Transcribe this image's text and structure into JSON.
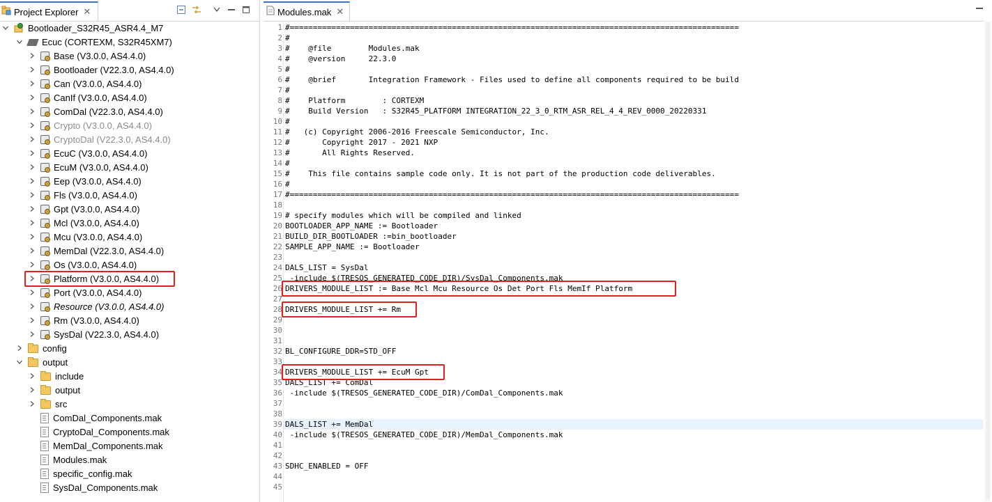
{
  "left_panel": {
    "tab_label": "Project Explorer",
    "tree": [
      {
        "label": "Bootloader_S32R45_ASR4.4_M7",
        "depth": 0,
        "expanded": true,
        "icon": "project-icon"
      },
      {
        "label": "Ecuc (CORTEXM, S32R45XM7)",
        "depth": 1,
        "expanded": true,
        "icon": "chip-icon"
      },
      {
        "label": "Base (V3.0.0, AS4.4.0)",
        "depth": 2,
        "icon": "module-icon"
      },
      {
        "label": "Bootloader (V22.3.0, AS4.4.0)",
        "depth": 2,
        "icon": "module-icon"
      },
      {
        "label": "Can (V3.0.0, AS4.4.0)",
        "depth": 2,
        "icon": "module-icon"
      },
      {
        "label": "CanIf (V3.0.0, AS4.4.0)",
        "depth": 2,
        "icon": "module-icon"
      },
      {
        "label": "ComDal (V22.3.0, AS4.4.0)",
        "depth": 2,
        "icon": "module-icon"
      },
      {
        "label": "Crypto (V3.0.0, AS4.4.0)",
        "depth": 2,
        "icon": "module-icon",
        "disabled": true
      },
      {
        "label": "CryptoDal (V22.3.0, AS4.4.0)",
        "depth": 2,
        "icon": "module-icon",
        "disabled": true
      },
      {
        "label": "EcuC (V3.0.0, AS4.4.0)",
        "depth": 2,
        "icon": "module-icon"
      },
      {
        "label": "EcuM (V3.0.0, AS4.4.0)",
        "depth": 2,
        "icon": "module-icon"
      },
      {
        "label": "Eep (V3.0.0, AS4.4.0)",
        "depth": 2,
        "icon": "module-icon"
      },
      {
        "label": "Fls (V3.0.0, AS4.4.0)",
        "depth": 2,
        "icon": "module-icon"
      },
      {
        "label": "Gpt (V3.0.0, AS4.4.0)",
        "depth": 2,
        "icon": "module-icon"
      },
      {
        "label": "Mcl (V3.0.0, AS4.4.0)",
        "depth": 2,
        "icon": "module-icon"
      },
      {
        "label": "Mcu (V3.0.0, AS4.4.0)",
        "depth": 2,
        "icon": "module-icon"
      },
      {
        "label": "MemDal (V22.3.0, AS4.4.0)",
        "depth": 2,
        "icon": "module-icon"
      },
      {
        "label": "Os (V3.0.0, AS4.4.0)",
        "depth": 2,
        "icon": "module-icon"
      },
      {
        "label": "Platform (V3.0.0, AS4.4.0)",
        "depth": 2,
        "icon": "module-icon",
        "highlighted": true
      },
      {
        "label": "Port (V3.0.0, AS4.4.0)",
        "depth": 2,
        "icon": "module-icon"
      },
      {
        "label": "Resource (V3.0.0, AS4.4.0)",
        "depth": 2,
        "icon": "module-icon",
        "italic": true
      },
      {
        "label": "Rm (V3.0.0, AS4.4.0)",
        "depth": 2,
        "icon": "module-icon"
      },
      {
        "label": "SysDal (V22.3.0, AS4.4.0)",
        "depth": 2,
        "icon": "module-icon"
      },
      {
        "label": "config",
        "depth": 1,
        "expanded": false,
        "icon": "folder-icon"
      },
      {
        "label": "output",
        "depth": 1,
        "expanded": true,
        "icon": "folder-icon"
      },
      {
        "label": "include",
        "depth": 2,
        "expanded": false,
        "icon": "folder-icon"
      },
      {
        "label": "output",
        "depth": 2,
        "expanded": false,
        "icon": "folder-icon"
      },
      {
        "label": "src",
        "depth": 2,
        "expanded": false,
        "icon": "folder-icon"
      },
      {
        "label": "ComDal_Components.mak",
        "depth": 2,
        "icon": "file-icon",
        "leaf": true
      },
      {
        "label": "CryptoDal_Components.mak",
        "depth": 2,
        "icon": "file-icon",
        "leaf": true
      },
      {
        "label": "MemDal_Components.mak",
        "depth": 2,
        "icon": "file-icon",
        "leaf": true
      },
      {
        "label": "Modules.mak",
        "depth": 2,
        "icon": "file-icon",
        "leaf": true
      },
      {
        "label": "specific_config.mak",
        "depth": 2,
        "icon": "file-icon",
        "leaf": true
      },
      {
        "label": "SysDal_Components.mak",
        "depth": 2,
        "icon": "file-icon",
        "leaf": true
      }
    ]
  },
  "editor": {
    "tab_label": "Modules.mak",
    "lines": [
      "#=================================================================================================",
      "#",
      "#    @file        Modules.mak",
      "#    @version     22.3.0",
      "#",
      "#    @brief       Integration Framework - Files used to define all components required to be build",
      "#",
      "#    Platform        : CORTEXM",
      "#    Build Version   : S32R45_PLATFORM INTEGRATION_22_3_0_RTM_ASR_REL_4_4_REV_0000_20220331",
      "#",
      "#   (c) Copyright 2006-2016 Freescale Semiconductor, Inc.",
      "#       Copyright 2017 - 2021 NXP",
      "#       All Rights Reserved.",
      "#",
      "#    This file contains sample code only. It is not part of the production code deliverables.",
      "#",
      "#=================================================================================================",
      "",
      "# specify modules which will be compiled and linked",
      "BOOTLOADER_APP_NAME := Bootloader",
      "BUILD_DIR_BOOTLOADER :=bin_bootloader",
      "SAMPLE_APP_NAME := Bootloader",
      "",
      "DALS_LIST = SysDal",
      " -include $(TRESOS_GENERATED_CODE_DIR)/SysDal_Components.mak",
      "DRIVERS_MODULE_LIST := Base Mcl Mcu Resource Os Det Port Fls MemIf Platform",
      "",
      "DRIVERS_MODULE_LIST += Rm",
      "",
      "",
      "",
      "BL_CONFIGURE_DDR=STD_OFF",
      "",
      "DRIVERS_MODULE_LIST += EcuM Gpt",
      "DALS_LIST += ComDal",
      " -include $(TRESOS_GENERATED_CODE_DIR)/ComDal_Components.mak",
      "",
      "",
      "DALS_LIST += MemDal",
      " -include $(TRESOS_GENERATED_CODE_DIR)/MemDal_Components.mak",
      "",
      "",
      "SDHC_ENABLED = OFF",
      "",
      "",
      ""
    ],
    "line_numbers": [
      "1",
      "2",
      "3",
      "4",
      "5",
      "6",
      "7",
      "8",
      "9",
      "10",
      "11",
      "12",
      "13",
      "14",
      "15",
      "16",
      "17",
      "18",
      "19",
      "20",
      "21",
      "22",
      "23",
      "24",
      "25",
      "26",
      "27",
      "28",
      "29",
      "30",
      "31",
      "32",
      "33",
      "34",
      "35",
      "36",
      "37",
      "38",
      "39",
      "40",
      "41",
      "42",
      "43",
      "44",
      "45"
    ],
    "current_line": 39
  },
  "colors": {
    "highlight_box": "#e02020",
    "tab_accent": "#3a74b8",
    "current_line_bg": "#e8f2fe"
  }
}
